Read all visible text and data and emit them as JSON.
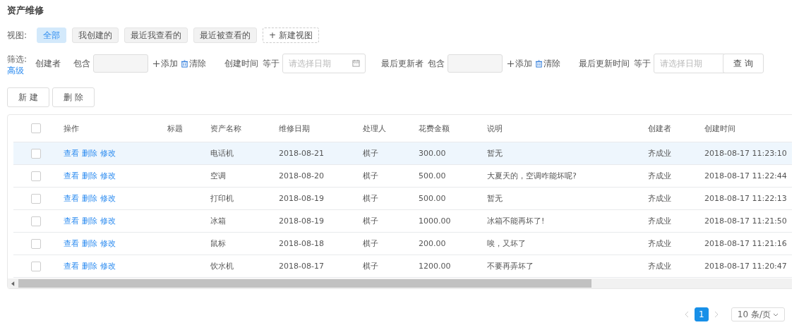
{
  "page_title": "资产维修",
  "views": {
    "label": "视图:",
    "items": [
      {
        "label": "全部",
        "selected": true
      },
      {
        "label": "我创建的",
        "selected": false
      },
      {
        "label": "最近我查看的",
        "selected": false
      },
      {
        "label": "最近被查看的",
        "selected": false
      }
    ],
    "new_view": "+ 新建视图"
  },
  "filter": {
    "label": "筛选:",
    "advanced": "高级",
    "items": [
      {
        "kind": "text",
        "field": "创建者",
        "op": "包含",
        "add": "添加",
        "clear": "清除"
      },
      {
        "kind": "date",
        "field": "创建时间",
        "op": "等于",
        "placeholder": "请选择日期",
        "calendar_icon": true
      },
      {
        "kind": "text",
        "field": "最后更新者",
        "op": "包含",
        "add": "添加",
        "clear": "清除"
      },
      {
        "kind": "date",
        "field": "最后更新时间",
        "op": "等于",
        "placeholder": "请选择日期",
        "calendar_icon": false
      }
    ],
    "query": "查 询"
  },
  "actions": [
    "新 建",
    "删 除"
  ],
  "table": {
    "select_all": {
      "checked": false
    },
    "action_column": "操作",
    "columns": [
      "标题",
      "资产名称",
      "维修日期",
      "处理人",
      "花费金额",
      "说明",
      "创建者",
      "创建时间"
    ],
    "rows": [
      {
        "checked": false,
        "highlighted": true,
        "links": [
          "查看",
          "删除",
          "修改"
        ],
        "cells": [
          "",
          "电话机",
          "2018-08-21",
          "棋子",
          "300.00",
          "暂无",
          "齐成业",
          "2018-08-17 11:23:10"
        ]
      },
      {
        "checked": false,
        "highlighted": false,
        "links": [
          "查看",
          "删除",
          "修改"
        ],
        "cells": [
          "",
          "空调",
          "2018-08-20",
          "棋子",
          "500.00",
          "大夏天的，空调咋能坏呢?",
          "齐成业",
          "2018-08-17 11:22:44"
        ]
      },
      {
        "checked": false,
        "highlighted": false,
        "links": [
          "查看",
          "删除",
          "修改"
        ],
        "cells": [
          "",
          "打印机",
          "2018-08-19",
          "棋子",
          "500.00",
          "暂无",
          "齐成业",
          "2018-08-17 11:22:13"
        ]
      },
      {
        "checked": false,
        "highlighted": false,
        "links": [
          "查看",
          "删除",
          "修改"
        ],
        "cells": [
          "",
          "冰箱",
          "2018-08-19",
          "棋子",
          "1000.00",
          "冰箱不能再坏了!",
          "齐成业",
          "2018-08-17 11:21:50"
        ]
      },
      {
        "checked": false,
        "highlighted": false,
        "links": [
          "查看",
          "删除",
          "修改"
        ],
        "cells": [
          "",
          "鼠标",
          "2018-08-18",
          "棋子",
          "200.00",
          "唉，又坏了",
          "齐成业",
          "2018-08-17 11:21:16"
        ]
      },
      {
        "checked": false,
        "highlighted": false,
        "links": [
          "查看",
          "删除",
          "修改"
        ],
        "cells": [
          "",
          "饮水机",
          "2018-08-17",
          "棋子",
          "1200.00",
          "不要再弄坏了",
          "齐成业",
          "2018-08-17 11:20:47"
        ]
      }
    ]
  },
  "pagination": {
    "pages": [
      {
        "label": "1",
        "selected": true
      }
    ],
    "page_size": "10 条/页"
  }
}
